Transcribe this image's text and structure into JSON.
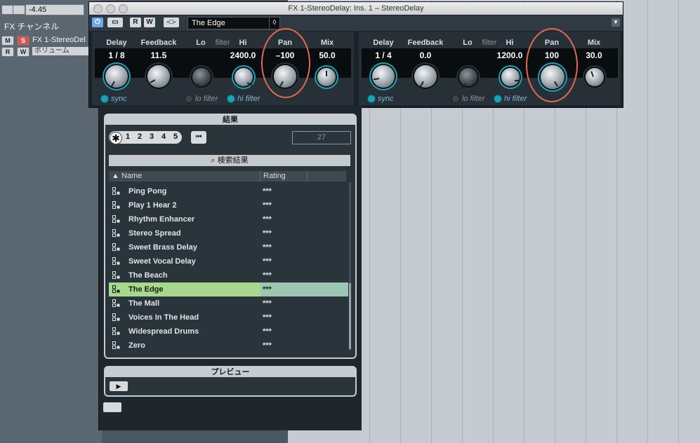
{
  "inspector": {
    "volume_value": "-4.45",
    "fx_channel_label": "FX チャンネル",
    "track_name": "FX 1-StereoDel",
    "volume_label": "ボリューム",
    "buttons": {
      "mute": "M",
      "solo": "S",
      "read": "R",
      "write": "W"
    }
  },
  "plugin": {
    "window_title": "FX 1-StereoDelay: Ins. 1 – StereoDelay",
    "toolbar": {
      "read": "R",
      "write": "W"
    },
    "preset_name": "The Edge",
    "delay1": {
      "labels": {
        "delay": "Delay",
        "feedback": "Feedback",
        "lo": "Lo",
        "filter": "filter",
        "hi": "Hi",
        "pan": "Pan",
        "mix": "Mix"
      },
      "values": {
        "delay": "1 / 8",
        "feedback": "11.5",
        "hi": "2400.0",
        "pan": "–100",
        "mix": "50.0"
      },
      "switches": {
        "sync": "sync",
        "lo_filter": "lo filter",
        "hi_filter": "hi filter"
      }
    },
    "delay2": {
      "labels": {
        "delay": "Delay",
        "feedback": "Feedback",
        "lo": "Lo",
        "filter": "filter",
        "hi": "Hi",
        "pan": "Pan",
        "mix": "Mix"
      },
      "values": {
        "delay": "1 / 4",
        "feedback": "0.0",
        "hi": "1200.0",
        "pan": "100",
        "mix": "30.0"
      },
      "switches": {
        "sync": "sync",
        "lo_filter": "lo filter",
        "hi_filter": "hi filter"
      }
    }
  },
  "browser": {
    "results_title": "結果",
    "rating_filter": [
      "1",
      "2",
      "3",
      "4",
      "5"
    ],
    "result_count": "27",
    "search_results_label": "検索結果",
    "columns": {
      "name": "Name",
      "rating": "Rating"
    },
    "presets": [
      {
        "name": "Ping Pong",
        "rating": "***"
      },
      {
        "name": "Play 1 Hear 2",
        "rating": "***"
      },
      {
        "name": "Rhythm Enhancer",
        "rating": "***"
      },
      {
        "name": "Stereo Spread",
        "rating": "***"
      },
      {
        "name": "Sweet Brass Delay",
        "rating": "***"
      },
      {
        "name": "Sweet Vocal Delay",
        "rating": "***"
      },
      {
        "name": "The Beach",
        "rating": "***"
      },
      {
        "name": "The Edge",
        "rating": "***"
      },
      {
        "name": "The Mall",
        "rating": "***"
      },
      {
        "name": "Voices In The Head",
        "rating": "***"
      },
      {
        "name": "Widespread Drums",
        "rating": "***"
      },
      {
        "name": "Zero",
        "rating": "***"
      }
    ],
    "selected_preset": "The Edge",
    "preview_title": "プレビュー"
  },
  "colors": {
    "selection": "#a8d88e",
    "annotation_circle": "#e2694f",
    "knob_ring": "#1aa3b8"
  }
}
